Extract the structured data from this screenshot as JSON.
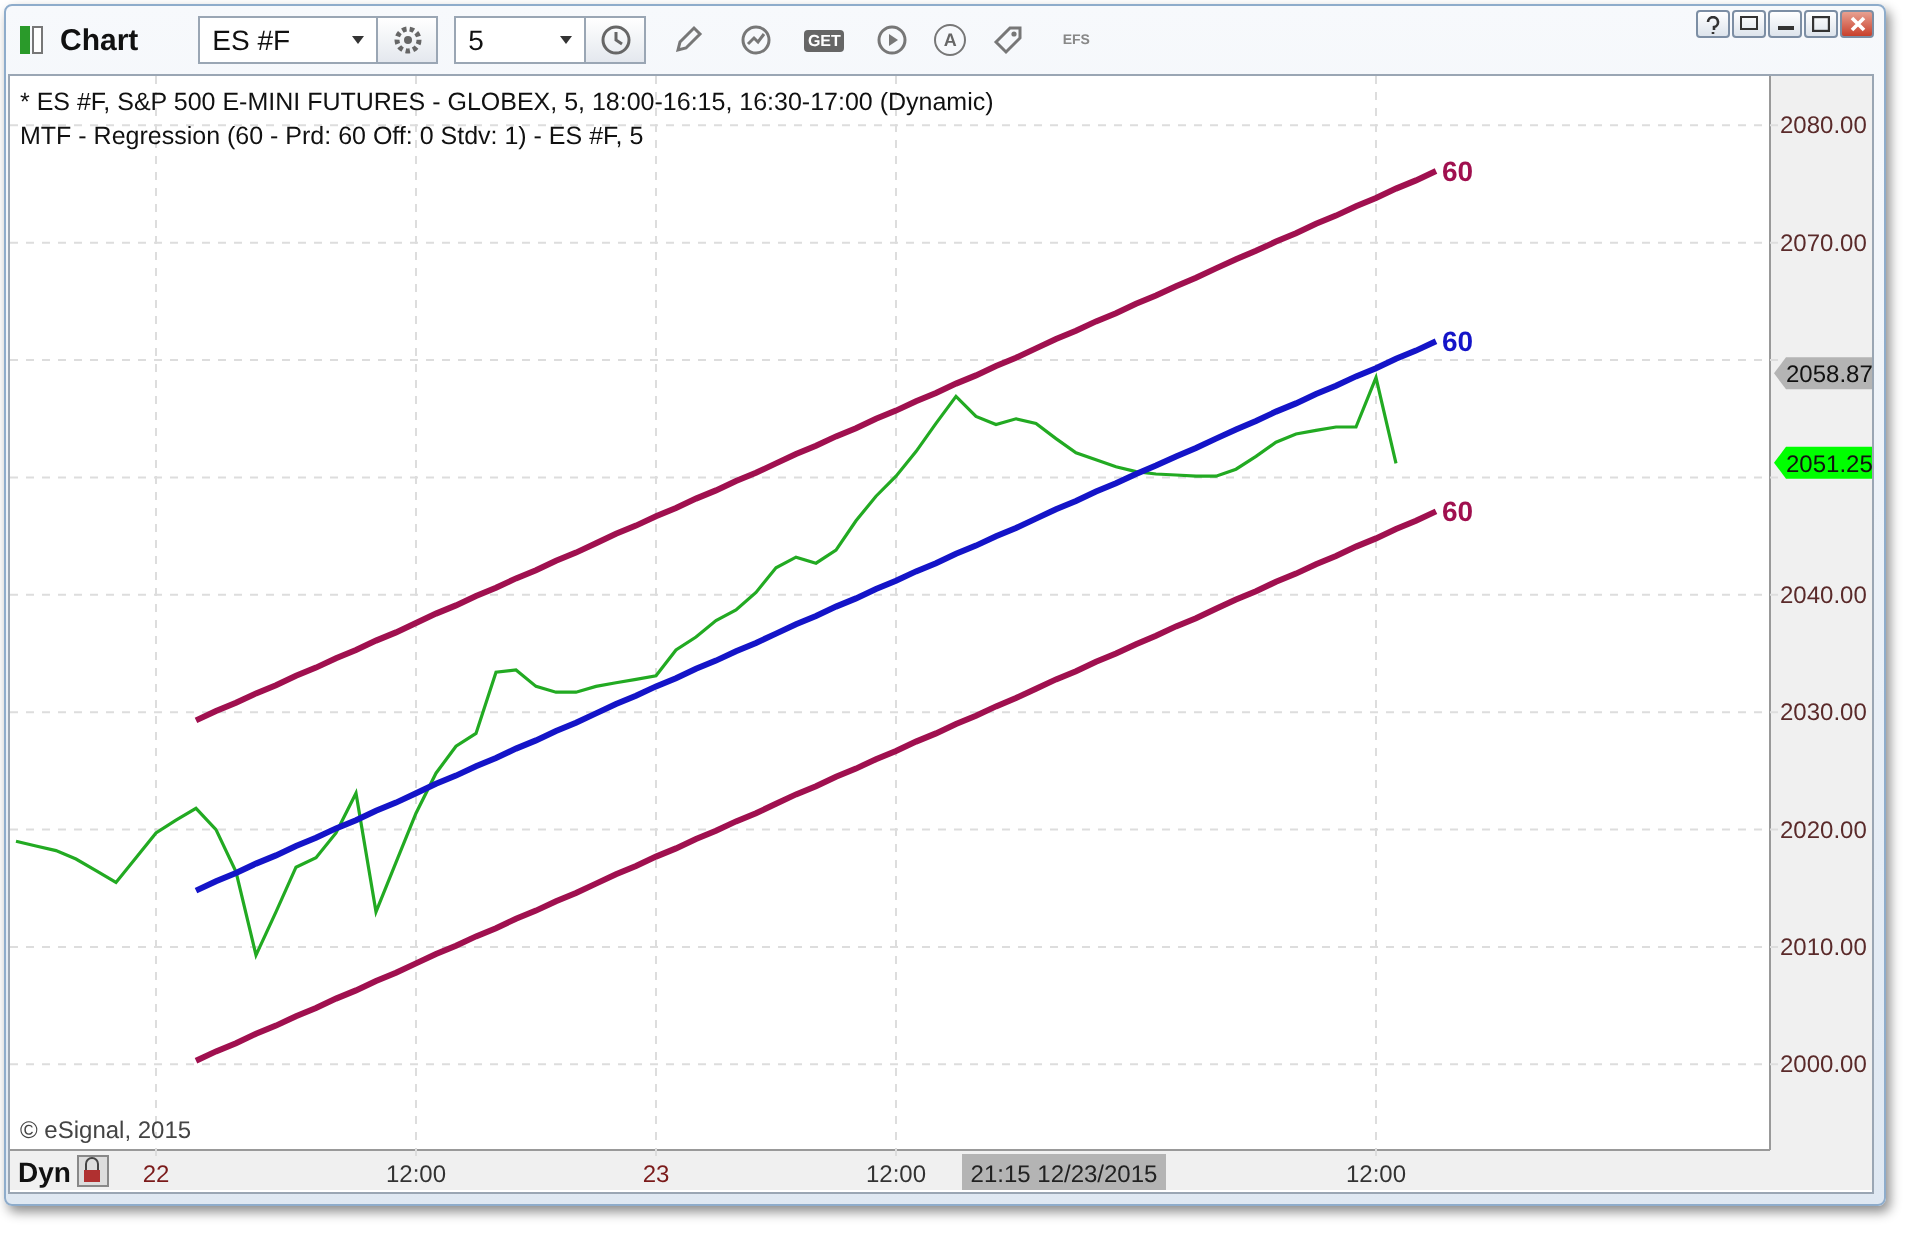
{
  "window": {
    "title": "Chart"
  },
  "toolbar": {
    "symbol_field": "ES #F",
    "interval_field": "5",
    "tools": [
      {
        "kind": "pencil"
      },
      {
        "kind": "chart"
      },
      {
        "kind": "badge",
        "label": "GET"
      },
      {
        "kind": "play"
      },
      {
        "kind": "letter",
        "label": "A"
      },
      {
        "kind": "tag"
      },
      {
        "kind": "text",
        "label": "EFS"
      }
    ]
  },
  "legend": [
    "* ES #F, S&P 500 E-MINI FUTURES - GLOBEX, 5, 18:00-16:15, 16:30-17:00 (Dynamic)",
    "MTF - Regression (60 - Prd: 60 Off: 0 Stdv: 1) - ES #F, 5"
  ],
  "copyright": "© eSignal, 2015",
  "price_badges": [
    {
      "label": "2058.87",
      "color": "#b4b4b4"
    },
    {
      "label": "2051.25",
      "color": "#00ff00"
    }
  ],
  "crosshair_time": "21:15 12/23/2015",
  "time_axis_mode": "Dyn",
  "chart_data": {
    "type": "line",
    "grid": true,
    "categories": [
      null,
      null,
      null,
      null,
      null,
      null,
      null,
      "22",
      null,
      null,
      null,
      null,
      null,
      null,
      null,
      null,
      null,
      null,
      null,
      null,
      "12:00",
      null,
      null,
      null,
      null,
      null,
      null,
      null,
      null,
      null,
      null,
      null,
      "23",
      null,
      null,
      null,
      null,
      null,
      null,
      null,
      null,
      null,
      null,
      null,
      "12:00",
      null,
      null,
      null,
      null,
      null,
      null,
      null,
      null,
      null,
      null,
      null,
      null,
      null,
      null,
      null,
      null,
      null,
      null,
      null,
      null,
      null,
      null,
      null,
      "12:00",
      null,
      null,
      null
    ],
    "series": [
      {
        "color": "#22aa22",
        "values": [
          2019.0,
          2018.6,
          2018.2,
          2017.5,
          2016.5,
          2015.5,
          2017.6,
          2019.7,
          2020.8,
          2021.8,
          2020.0,
          2016.4,
          2009.3,
          2013.0,
          2016.8,
          2017.6,
          2019.7,
          2023.1,
          2013.0,
          2017.2,
          2021.4,
          2024.8,
          2027.1,
          2028.2,
          2033.4,
          2033.6,
          2032.2,
          2031.7,
          2031.7,
          2032.2,
          2032.5,
          2032.8,
          2033.1,
          2035.3,
          2036.4,
          2037.8,
          2038.7,
          2040.2,
          2042.3,
          2043.2,
          2042.7,
          2043.8,
          2046.3,
          2048.4,
          2050.1,
          2052.2,
          2054.6,
          2056.9,
          2055.2,
          2054.5,
          2055.0,
          2054.6,
          2053.3,
          2052.1,
          2051.5,
          2050.9,
          2050.5,
          2050.3,
          2050.2,
          2050.1,
          2050.1,
          2050.7,
          2051.8,
          2053.0,
          2053.7,
          2054.0,
          2054.3,
          2054.3,
          2058.5,
          2051.2,
          null,
          null
        ]
      },
      {
        "name": "60",
        "color": "#a0104f",
        "values": [
          null,
          null,
          null,
          null,
          null,
          null,
          null,
          null,
          null,
          2029.3,
          2030.1,
          2030.8,
          2031.6,
          2032.3,
          2033.1,
          2033.8,
          2034.6,
          2035.3,
          2036.1,
          2036.8,
          2037.6,
          2038.4,
          2039.1,
          2039.9,
          2040.6,
          2041.4,
          2042.1,
          2042.9,
          2043.6,
          2044.4,
          2045.2,
          2045.9,
          2046.7,
          2047.4,
          2048.2,
          2048.9,
          2049.7,
          2050.4,
          2051.2,
          2052.0,
          2052.7,
          2053.5,
          2054.2,
          2055.0,
          2055.7,
          2056.5,
          2057.2,
          2058.0,
          2058.7,
          2059.5,
          2060.2,
          2061.0,
          2061.8,
          2062.5,
          2063.3,
          2064.0,
          2064.8,
          2065.5,
          2066.3,
          2067.0,
          2067.8,
          2068.6,
          2069.3,
          2070.1,
          2070.8,
          2071.6,
          2072.3,
          2073.1,
          2073.8,
          2074.6,
          2075.3,
          2076.1
        ]
      },
      {
        "name": "60",
        "color": "#1414c8",
        "values": [
          null,
          null,
          null,
          null,
          null,
          null,
          null,
          null,
          null,
          2014.8,
          2015.6,
          2016.3,
          2017.1,
          2017.8,
          2018.6,
          2019.3,
          2020.1,
          2020.8,
          2021.6,
          2022.3,
          2023.1,
          2023.9,
          2024.6,
          2025.4,
          2026.1,
          2026.9,
          2027.6,
          2028.4,
          2029.1,
          2029.9,
          2030.7,
          2031.4,
          2032.2,
          2032.9,
          2033.7,
          2034.4,
          2035.2,
          2035.9,
          2036.7,
          2037.5,
          2038.2,
          2039.0,
          2039.7,
          2040.5,
          2041.2,
          2042.0,
          2042.7,
          2043.5,
          2044.2,
          2045.0,
          2045.7,
          2046.5,
          2047.3,
          2048.0,
          2048.8,
          2049.5,
          2050.3,
          2051.0,
          2051.8,
          2052.5,
          2053.3,
          2054.1,
          2054.8,
          2055.6,
          2056.3,
          2057.1,
          2057.8,
          2058.6,
          2059.3,
          2060.1,
          2060.8,
          2061.6
        ]
      },
      {
        "name": "60",
        "color": "#a0104f",
        "values": [
          null,
          null,
          null,
          null,
          null,
          null,
          null,
          null,
          null,
          2000.3,
          2001.1,
          2001.8,
          2002.6,
          2003.3,
          2004.1,
          2004.8,
          2005.6,
          2006.3,
          2007.1,
          2007.8,
          2008.6,
          2009.4,
          2010.1,
          2010.9,
          2011.6,
          2012.4,
          2013.1,
          2013.9,
          2014.6,
          2015.4,
          2016.2,
          2016.9,
          2017.7,
          2018.4,
          2019.2,
          2019.9,
          2020.7,
          2021.4,
          2022.2,
          2023.0,
          2023.7,
          2024.5,
          2025.2,
          2026.0,
          2026.7,
          2027.5,
          2028.2,
          2029.0,
          2029.7,
          2030.5,
          2031.2,
          2032.0,
          2032.8,
          2033.5,
          2034.3,
          2035.0,
          2035.8,
          2036.5,
          2037.3,
          2038.0,
          2038.8,
          2039.6,
          2040.3,
          2041.1,
          2041.8,
          2042.6,
          2043.3,
          2044.1,
          2044.8,
          2045.6,
          2046.3,
          2047.1
        ]
      }
    ],
    "ylim": [
      1992.7,
      2084.2
    ],
    "yticks": [
      {
        "value": 2000,
        "label": "2000.00"
      },
      {
        "value": 2010,
        "label": "2010.00"
      },
      {
        "value": 2020,
        "label": "2020.00"
      },
      {
        "value": 2030,
        "label": "2030.00"
      },
      {
        "value": 2040,
        "label": "2040.00"
      },
      {
        "value": 2070,
        "label": "2070.00"
      },
      {
        "value": 2080,
        "label": "2080.00"
      }
    ]
  }
}
